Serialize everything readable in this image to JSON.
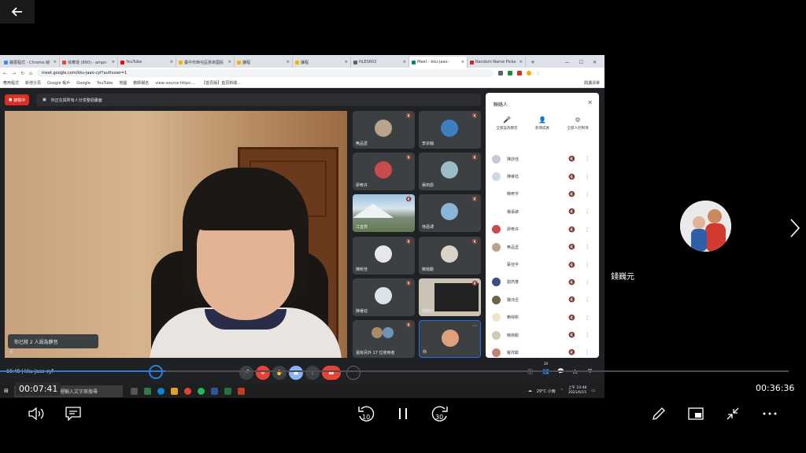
{
  "player": {
    "back_label": "←",
    "prev_label": "‹",
    "next_label": "›",
    "current_time": "00:07:41",
    "total_time": "00:36:36",
    "progress": 0.21,
    "skip_back_label": "10",
    "skip_forward_label": "30",
    "right_participant_name": "錢巍元"
  },
  "browser": {
    "tabs": [
      {
        "label": "擴展程式 - Chrome 線",
        "color": "#4285f4",
        "active": false
      },
      {
        "label": "徐華運 (860) - ampn",
        "color": "#ea4335",
        "active": false
      },
      {
        "label": "YouTube",
        "color": "#ff0000",
        "active": false
      },
      {
        "label": "臺中市西屯區惠來國民",
        "color": "#f4b400",
        "active": false
      },
      {
        "label": "課程",
        "color": "#f4b400",
        "active": false
      },
      {
        "label": "課程",
        "color": "#f4b400",
        "active": false
      },
      {
        "label": "HLES602",
        "color": "#5f6368",
        "active": false
      },
      {
        "label": "Meet - kku-jaao-",
        "color": "#00897b",
        "active": true
      },
      {
        "label": "Random Name Picke",
        "color": "#c62828",
        "active": false
      }
    ],
    "new_tab": "+",
    "url": "meet.google.com/kku-jaao-cyf?authuser=1",
    "bookmarks": [
      "應用程式",
      "新增分頁",
      "Google 帳戶",
      "Google",
      "YouTube",
      "地圖",
      "教師報名",
      "view-source:https:...",
      "【首頁版】首頁新聞..."
    ],
    "bookmarks_right": "閱讀清單"
  },
  "meet": {
    "rec_label": "錄製中",
    "present_label": "你正在與所有人分享整個畫面",
    "muted_toast": "你已將 2 人設為靜音",
    "self_name": "我",
    "tiles": [
      {
        "name": "無品壹",
        "color": "#b9a38a"
      },
      {
        "name": "李宗翰",
        "color": "#3c7fc2"
      },
      {
        "name": "廖宥卉",
        "color": "#c94b4b"
      },
      {
        "name": "黃田恩",
        "color": "#9bbcc9"
      },
      {
        "name": "江宜燕",
        "color": "landscape"
      },
      {
        "name": "林函溥",
        "color": "#8ab4d8"
      },
      {
        "name": "陳昕佳",
        "color": "#e6e6ec"
      },
      {
        "name": "簡荷勳",
        "color": "#d7d4c7"
      },
      {
        "name": "陳睿廷",
        "color": "#dde3ea"
      },
      {
        "name": "錢巍元",
        "color": "screen"
      },
      {
        "name": "還有另外 17 位使用者",
        "color": "more"
      },
      {
        "name": "你",
        "color": "#e0a07a"
      }
    ],
    "panel": {
      "title": "聯絡人",
      "actions": [
        {
          "label": "全部設為靜音",
          "icon": "🎤"
        },
        {
          "label": "新增成員",
          "icon": "👤"
        },
        {
          "label": "全部人控制項",
          "icon": "⚙"
        }
      ],
      "people": [
        {
          "name": "陳詩佳",
          "color": "#c9c9d6"
        },
        {
          "name": "陳睿廷",
          "color": "#cfd8e3"
        },
        {
          "name": "簡宥宇",
          "color": "#ffffff"
        },
        {
          "name": "楊承諺",
          "color": "#ffffff"
        },
        {
          "name": "廖宥卉",
          "color": "#c94b4b"
        },
        {
          "name": "無品壹",
          "color": "#b9a38a"
        },
        {
          "name": "蔡佳宇",
          "color": "#ffffff"
        },
        {
          "name": "劉芮蓬",
          "color": "#3b4f86"
        },
        {
          "name": "魏沛丞",
          "color": "#6b6248"
        },
        {
          "name": "賴崢帆",
          "color": "#f0e3cf"
        },
        {
          "name": "簡荷勳",
          "color": "#cfc9b8"
        },
        {
          "name": "羅祥勳",
          "color": "#c2827a"
        }
      ]
    },
    "controls": {
      "time_label": "10:48 | kku-jaao-cyf",
      "icons": [
        "mic-icon",
        "camera-off-icon",
        "raise-hand-icon",
        "captions-icon",
        "present-icon",
        "more-icon",
        "end-call-icon"
      ],
      "right_badge": "29"
    }
  },
  "taskbar": {
    "search_placeholder": "在這裡輸入文字來搜尋",
    "weather": "29°C 小雨",
    "time": "上午 10:48",
    "date": "2021/6/15"
  },
  "colors": {
    "accent": "#2f7bd9",
    "rec_red": "#d93025",
    "meet_bg": "#202124"
  }
}
